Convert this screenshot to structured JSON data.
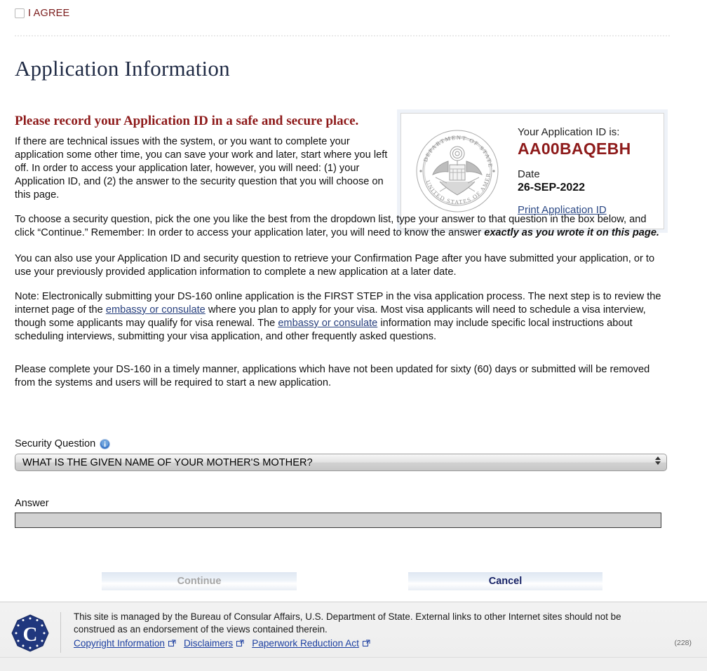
{
  "agree": {
    "label": "I AGREE",
    "checkbox_icon": "checkbox-unchecked-icon",
    "checked": false,
    "color": "#7b1c1c"
  },
  "page_title": "Application Information",
  "body": {
    "heading": "Please record your Application ID in a safe and secure place.",
    "heading_color": "#8e1b1b",
    "paragraph_1": "If there are technical issues with the system, or you want to complete your application some other time, you can save your work and later, start where you left off. In order to access your application later, however, you will need: (1) your Application ID, and (2) the answer to the security question that you will choose on this page.",
    "paragraph_2_lead": "To choose a security question, pick the one you like the best from the dropdown list, type your answer to that question in the box below, and click “Continue.” Remember: In order to access your application later, you will need to know the answer ",
    "paragraph_2_emphasis": "exactly as you wrote it on this page.",
    "paragraph_3": "You can also use your Application ID and security question to retrieve your Confirmation Page after you have submitted your application, or to use your previously provided application information to complete a new application at a later date.",
    "paragraph_4_a": "Note: Electronically submitting your DS-160 online application is the FIRST STEP in the visa application process. The next step is to review the internet page of the ",
    "paragraph_4_link1": "embassy or consulate",
    "paragraph_4_b": " where you plan to apply for your visa. Most visa applicants will need to schedule a visa interview, though some applicants may qualify for visa renewal. The ",
    "paragraph_4_link2": "embassy or consulate",
    "paragraph_4_c": " information may include specific local instructions about scheduling interviews, submitting your visa application, and other frequently asked questions.",
    "paragraph_5": "Please complete your DS-160 in a timely manner, applications which have not been updated for sixty (60) days or submitted will be removed from the systems and users will be required to start a new application."
  },
  "id_panel": {
    "seal_icon": "department-of-state-seal-icon",
    "seal_text_top": "DEPARTMENT OF STATE",
    "seal_text_bottom": "UNITED STATES OF AMERICA",
    "app_id_label": "Your Application ID is:",
    "app_id_value": "AA00BAQEBH",
    "app_id_color": "#8e1b1b",
    "date_label": "Date",
    "date_value": "26-SEP-2022",
    "print_link": "Print Application ID"
  },
  "form": {
    "security_question_label": "Security Question",
    "info_icon": "info-icon",
    "security_question_value": "WHAT IS THE GIVEN NAME OF YOUR MOTHER'S MOTHER?",
    "security_question_options": [
      "WHAT IS THE GIVEN NAME OF YOUR MOTHER'S MOTHER?"
    ],
    "dropdown_icon": "updown-arrows-icon",
    "answer_label": "Answer",
    "answer_value": "",
    "answer_placeholder": ""
  },
  "buttons": {
    "continue_label": "Continue",
    "continue_disabled": true,
    "cancel_label": "Cancel",
    "cancel_color": "#141f63"
  },
  "footer": {
    "seal_icon": "consular-affairs-seal-icon",
    "seal_letter": "C",
    "text": "This site is managed by the Bureau of Consular Affairs, U.S. Department of State. External links to other Internet sites should not be construed as an endorsement of the views contained therein.",
    "links": [
      {
        "label": "Copyright Information",
        "icon": "external-link-icon"
      },
      {
        "label": "Disclaimers",
        "icon": "external-link-icon"
      },
      {
        "label": "Paperwork Reduction Act",
        "icon": "external-link-icon"
      }
    ],
    "page_code": "(228)"
  }
}
